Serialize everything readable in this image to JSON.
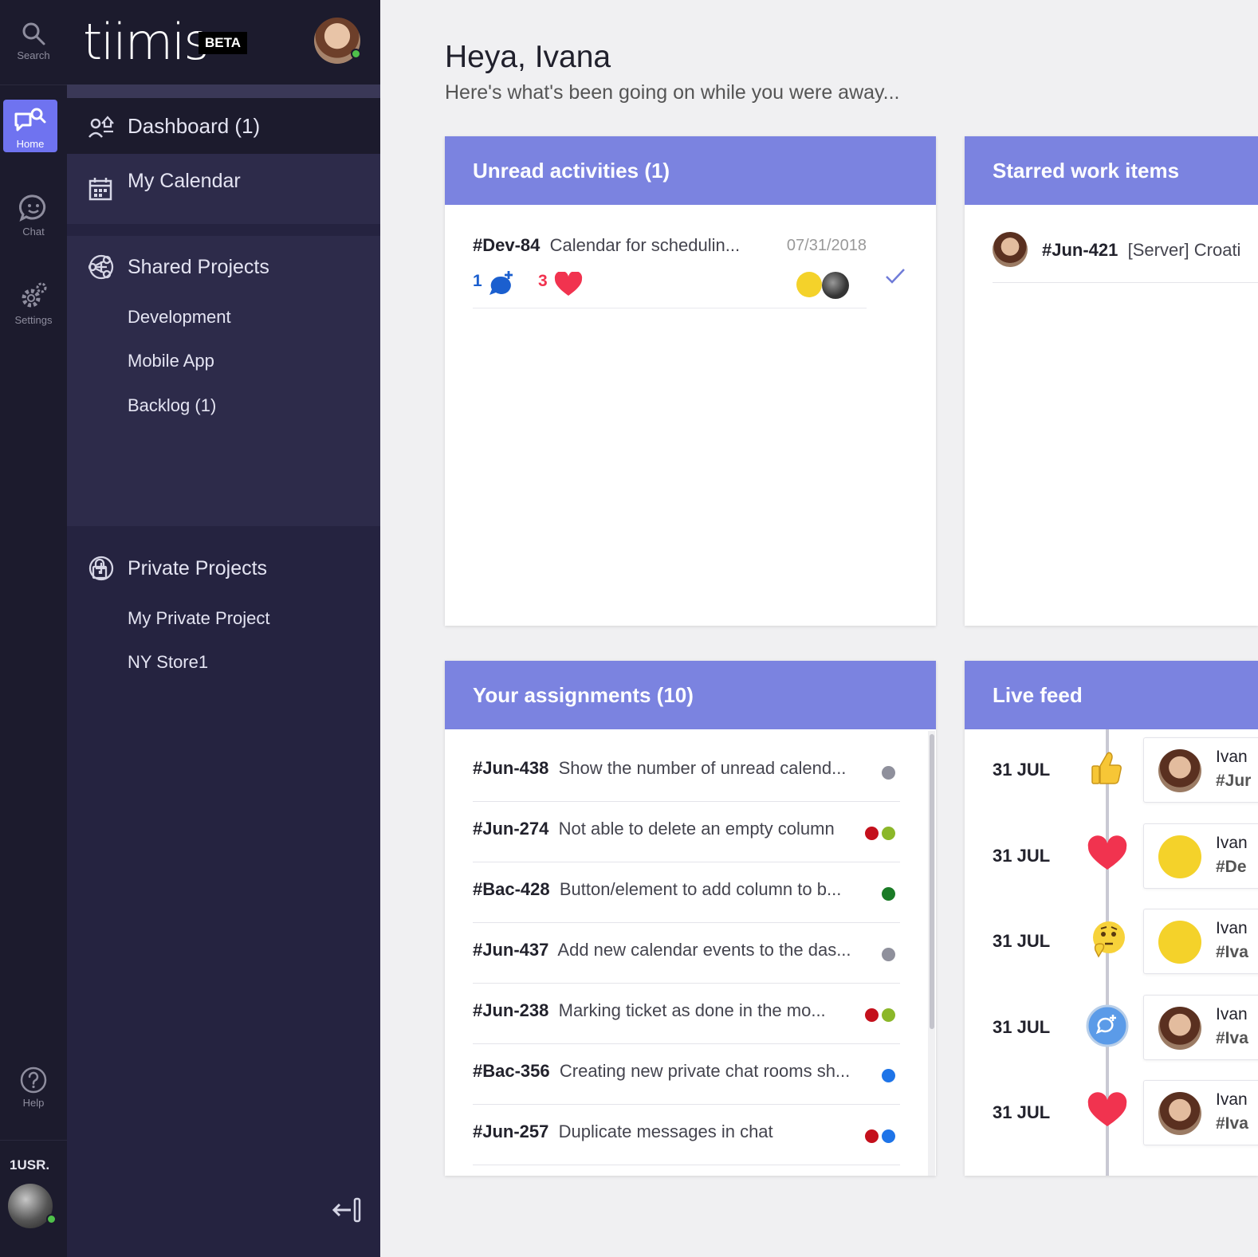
{
  "rail": {
    "search_label": "Search",
    "home_label": "Home",
    "chat_label": "Chat",
    "settings_label": "Settings",
    "help_label": "Help",
    "user_code": "1USR."
  },
  "brand": {
    "logo": "tiimis",
    "badge": "BETA"
  },
  "sidebar": {
    "dashboard": "Dashboard (1)",
    "calendar": "My Calendar",
    "shared_title": "Shared Projects",
    "shared": [
      "Development",
      "Mobile App",
      "Backlog (1)"
    ],
    "private_title": "Private Projects",
    "private": [
      "My Private Project",
      "NY Store1"
    ]
  },
  "header": {
    "greeting": "Heya, Ivana",
    "subtitle": "Here's what's been going on while you were away..."
  },
  "unread": {
    "title": "Unread activities (1)",
    "item": {
      "id": "#Dev-84",
      "text": "Calendar for schedulin...",
      "date": "07/31/2018",
      "comments": "1",
      "likes": "3"
    }
  },
  "starred": {
    "title": "Starred work items",
    "item": {
      "id": "#Jun-421",
      "text": "[Server] Croati"
    }
  },
  "assignments": {
    "title": "Your assignments (10)",
    "rows": [
      {
        "id": "#Jun-438",
        "text": "Show the number of unread calend...",
        "dots": [
          "#8f909c"
        ]
      },
      {
        "id": "#Jun-274",
        "text": "Not able to delete an empty column",
        "dots": [
          "#c4101c",
          "#8bb729"
        ]
      },
      {
        "id": "#Bac-428",
        "text": "Button/element to add column to b...",
        "dots": [
          "#1a7b26"
        ]
      },
      {
        "id": "#Jun-437",
        "text": "Add new calendar events to the das...",
        "dots": [
          "#8f909c"
        ]
      },
      {
        "id": "#Jun-238",
        "text": "Marking ticket as done in the mo...",
        "dots": [
          "#c4101c",
          "#8bb729"
        ]
      },
      {
        "id": "#Bac-356",
        "text": "Creating new private chat rooms sh...",
        "dots": [
          "#1e74e8"
        ]
      },
      {
        "id": "#Jun-257",
        "text": "Duplicate messages in chat",
        "dots": [
          "#c4101c",
          "#1e74e8"
        ]
      }
    ]
  },
  "feed": {
    "title": "Live feed",
    "items": [
      {
        "date": "31  JUL",
        "icon": "thumbs-up-icon",
        "avatar": "woman",
        "name": "Ivan",
        "ref": "#Jur"
      },
      {
        "date": "31  JUL",
        "icon": "heart-icon",
        "avatar": "yellow",
        "name": "Ivan",
        "ref": "#De"
      },
      {
        "date": "31  JUL",
        "icon": "thinking-face-icon",
        "avatar": "yellow",
        "name": "Ivan",
        "ref": "#Iva"
      },
      {
        "date": "31  JUL",
        "icon": "add-comment-icon",
        "avatar": "woman",
        "name": "Ivan",
        "ref": "#Iva"
      },
      {
        "date": "31  JUL",
        "icon": "heart-icon",
        "avatar": "woman",
        "name": "Ivan",
        "ref": "#Iva"
      }
    ]
  },
  "colors": {
    "accent": "#6f73f0",
    "card_header": "#7b83e0",
    "sidebar": "#252340",
    "rail": "#1c1b2d",
    "heart": "#f1334f",
    "comment_blue": "#1b5fcf"
  }
}
